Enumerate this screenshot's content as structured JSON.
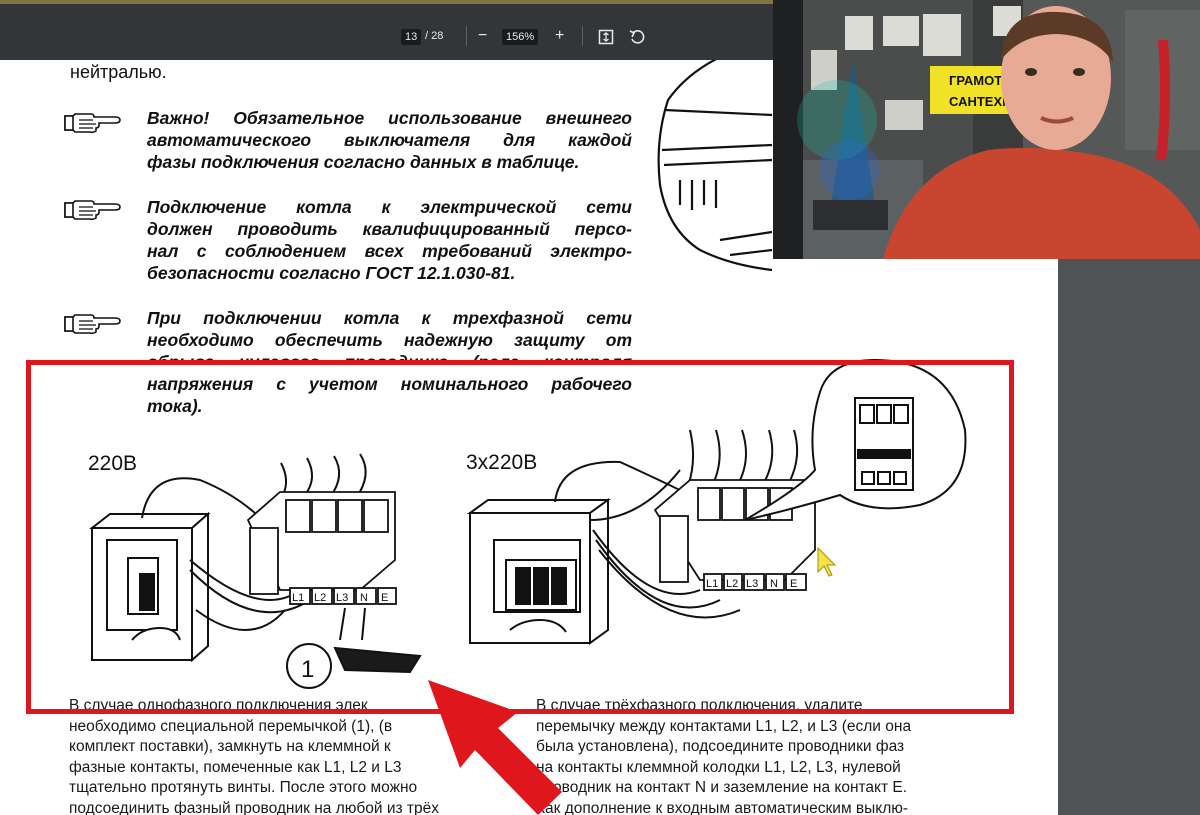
{
  "toolbar": {
    "page_current": "13",
    "page_total": "/ 28",
    "zoom_out": "−",
    "zoom": "156%",
    "zoom_in": "+",
    "icons": [
      "fit-to-page-icon",
      "rotate-icon"
    ],
    "background_color": "#323639"
  },
  "document": {
    "top_fragment": "нейтралью.",
    "notes": [
      {
        "lines": [
          "Важно! Обязательное использование внешнего",
          "автоматического выключателя для каждой",
          "фазы подключения согласно данных в таблице."
        ]
      },
      {
        "lines": [
          "Подключение котла к электрической сети",
          "должен проводить квалифицированный персо-",
          "нал с соблюдением всех требований электро-",
          "безопасности согласно ГОСТ 12.1.030-81."
        ]
      },
      {
        "lines": [
          "При подключении котла к трехфазной сети",
          "необходимо обеспечить надежную защиту от",
          "обрыва нулевого проводника (реле контроля",
          "напряжения с учетом номинального рабочего",
          "тока)."
        ]
      }
    ],
    "left_column": [
      "В случае однофазного подключения элек",
      "необходимо специальной перемычкой (1), (в",
      "комплект поставки), замкнуть на клеммной к",
      "фазные контакты, помеченные как L1, L2 и L3",
      "тщательно протянуть винты. После этого можно",
      "подсоединить фазный проводник на любой из трёх"
    ],
    "right_column": [
      "В случае трёхфазного подключения, удалите",
      "перемычку между контактами L1, L2, и L3 (если она",
      "была установлена), подсоедините проводники фаз",
      "на контакты клеммной колодки L1, L2, L3, нулевой",
      "проводник на контакт N и заземление на контакт E.",
      "Как дополнение к входным автоматическим выклю-"
    ]
  },
  "diagram": {
    "left_label": "220В",
    "right_label": "3x220В",
    "terminals": [
      "L1",
      "L2",
      "L3",
      "N",
      "E",
      "E"
    ],
    "jumper_callout": "1"
  },
  "annotation": {
    "highlight_color": "#e0161d"
  },
  "webcam": {
    "sign_line_1": "ГРАМОТН",
    "sign_line_2": "САНТЕХНИ"
  }
}
